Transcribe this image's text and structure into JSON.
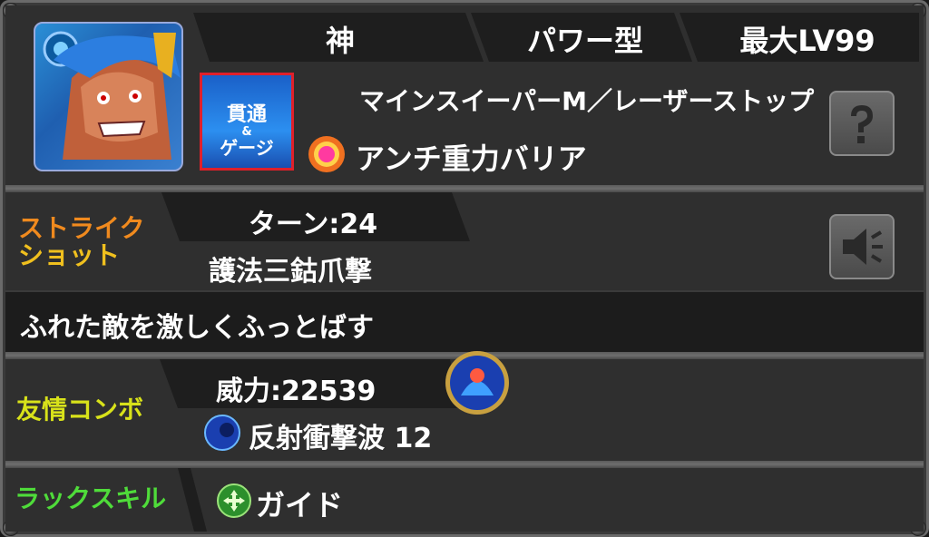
{
  "header": {
    "attribute": "神",
    "type": "パワー型",
    "max_level": "最大LV99"
  },
  "abilities": {
    "gauge_badge_line1": "貫通",
    "gauge_badge_amp": "&",
    "gauge_badge_line2": "ゲージ",
    "ability_main": "マインスイーパーM／レーザーストップ",
    "ability_gauge": "アンチ重力バリア"
  },
  "strike_shot": {
    "label_line1": "ストライク",
    "label_line2": "ショット",
    "turns": "ターン:24",
    "name": "護法三鈷爪撃",
    "description": "ふれた敵を激しくふっとばす"
  },
  "friendship_combo": {
    "label": "友情コンボ",
    "power": "威力:22539",
    "name": "反射衝撃波 12"
  },
  "luck_skill": {
    "label": "ラックスキル",
    "name": "ガイド"
  },
  "colors": {
    "strike_label": "#f08a1e",
    "friend_label": "#d8e21a",
    "luck_label": "#4fdc3a",
    "panel_bg": "#2f2f2f"
  },
  "icons": [
    "question-icon",
    "sound-icon",
    "gauge-badge-icon",
    "barrier-icon",
    "laser-bubble-icon",
    "guide-icon",
    "friend-combo-orb-icon"
  ]
}
